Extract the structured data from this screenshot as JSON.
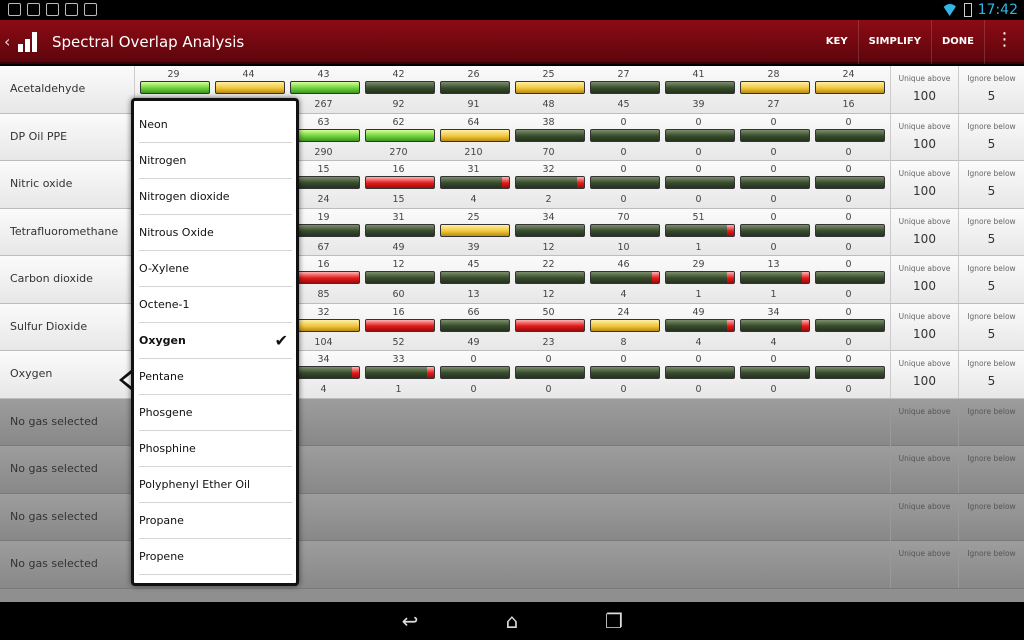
{
  "status_bar": {
    "time": "17:42",
    "notification_icons": [
      "download-icon",
      "image-icon",
      "android-icon",
      "shop-icon",
      "shop-icon"
    ]
  },
  "action_bar": {
    "title": "Spectral Overlap Analysis",
    "actions": [
      "KEY",
      "SIMPLIFY",
      "DONE"
    ]
  },
  "stat_labels": {
    "unique_above": "Unique above",
    "ignore_below": "Ignore below"
  },
  "rows": [
    {
      "gas": "Acetaldehyde",
      "unique_above": "100",
      "ignore_below": "5",
      "cells": [
        {
          "top": "29",
          "bot": "",
          "color": "green"
        },
        {
          "top": "44",
          "bot": "",
          "color": "yellow"
        },
        {
          "top": "43",
          "bot": "267",
          "color": "green"
        },
        {
          "top": "42",
          "bot": "92",
          "color": "dark"
        },
        {
          "top": "26",
          "bot": "91",
          "color": "dark"
        },
        {
          "top": "25",
          "bot": "48",
          "color": "yellow"
        },
        {
          "top": "27",
          "bot": "45",
          "color": "dark"
        },
        {
          "top": "41",
          "bot": "39",
          "color": "dark"
        },
        {
          "top": "28",
          "bot": "27",
          "color": "yellow"
        },
        {
          "top": "24",
          "bot": "16",
          "color": "yellow"
        }
      ]
    },
    {
      "gas": "DP Oil PPE",
      "unique_above": "100",
      "ignore_below": "5",
      "cells": [
        {
          "top": "",
          "bot": "",
          "color": "none"
        },
        {
          "top": "",
          "bot": "",
          "color": "none"
        },
        {
          "top": "63",
          "bot": "290",
          "color": "green"
        },
        {
          "top": "62",
          "bot": "270",
          "color": "green"
        },
        {
          "top": "64",
          "bot": "210",
          "color": "yellow"
        },
        {
          "top": "38",
          "bot": "70",
          "color": "dark"
        },
        {
          "top": "0",
          "bot": "0",
          "color": "dark"
        },
        {
          "top": "0",
          "bot": "0",
          "color": "dark"
        },
        {
          "top": "0",
          "bot": "0",
          "color": "dark"
        },
        {
          "top": "0",
          "bot": "0",
          "color": "dark"
        }
      ]
    },
    {
      "gas": "Nitric oxide",
      "unique_above": "100",
      "ignore_below": "5",
      "cells": [
        {
          "top": "",
          "bot": "",
          "color": "none"
        },
        {
          "top": "",
          "bot": "",
          "color": "none"
        },
        {
          "top": "15",
          "bot": "24",
          "color": "dark"
        },
        {
          "top": "16",
          "bot": "15",
          "color": "red"
        },
        {
          "top": "31",
          "bot": "4",
          "color": "darkred"
        },
        {
          "top": "32",
          "bot": "2",
          "color": "darkred"
        },
        {
          "top": "0",
          "bot": "0",
          "color": "dark"
        },
        {
          "top": "0",
          "bot": "0",
          "color": "dark"
        },
        {
          "top": "0",
          "bot": "0",
          "color": "dark"
        },
        {
          "top": "0",
          "bot": "0",
          "color": "dark"
        }
      ]
    },
    {
      "gas": "Tetrafluoromethane",
      "unique_above": "100",
      "ignore_below": "5",
      "cells": [
        {
          "top": "",
          "bot": "",
          "color": "none"
        },
        {
          "top": "",
          "bot": "",
          "color": "none"
        },
        {
          "top": "19",
          "bot": "67",
          "color": "dark"
        },
        {
          "top": "31",
          "bot": "49",
          "color": "dark"
        },
        {
          "top": "25",
          "bot": "39",
          "color": "yellow"
        },
        {
          "top": "34",
          "bot": "12",
          "color": "dark"
        },
        {
          "top": "70",
          "bot": "10",
          "color": "dark"
        },
        {
          "top": "51",
          "bot": "1",
          "color": "darkred"
        },
        {
          "top": "0",
          "bot": "0",
          "color": "dark"
        },
        {
          "top": "0",
          "bot": "0",
          "color": "dark"
        }
      ]
    },
    {
      "gas": "Carbon dioxide",
      "unique_above": "100",
      "ignore_below": "5",
      "cells": [
        {
          "top": "",
          "bot": "",
          "color": "none"
        },
        {
          "top": "",
          "bot": "",
          "color": "none"
        },
        {
          "top": "16",
          "bot": "85",
          "color": "red"
        },
        {
          "top": "12",
          "bot": "60",
          "color": "dark"
        },
        {
          "top": "45",
          "bot": "13",
          "color": "dark"
        },
        {
          "top": "22",
          "bot": "12",
          "color": "dark"
        },
        {
          "top": "46",
          "bot": "4",
          "color": "darkred"
        },
        {
          "top": "29",
          "bot": "1",
          "color": "darkred"
        },
        {
          "top": "13",
          "bot": "1",
          "color": "darkred"
        },
        {
          "top": "0",
          "bot": "0",
          "color": "dark"
        }
      ]
    },
    {
      "gas": "Sulfur Dioxide",
      "unique_above": "100",
      "ignore_below": "5",
      "cells": [
        {
          "top": "",
          "bot": "",
          "color": "none"
        },
        {
          "top": "",
          "bot": "",
          "color": "none"
        },
        {
          "top": "32",
          "bot": "104",
          "color": "yellow"
        },
        {
          "top": "16",
          "bot": "52",
          "color": "red"
        },
        {
          "top": "66",
          "bot": "49",
          "color": "dark"
        },
        {
          "top": "50",
          "bot": "23",
          "color": "red"
        },
        {
          "top": "24",
          "bot": "8",
          "color": "yellow"
        },
        {
          "top": "49",
          "bot": "4",
          "color": "darkred"
        },
        {
          "top": "34",
          "bot": "4",
          "color": "darkred"
        },
        {
          "top": "0",
          "bot": "0",
          "color": "dark"
        }
      ]
    },
    {
      "gas": "Oxygen",
      "unique_above": "100",
      "ignore_below": "5",
      "cells": [
        {
          "top": "",
          "bot": "",
          "color": "none"
        },
        {
          "top": "",
          "bot": "",
          "color": "none"
        },
        {
          "top": "34",
          "bot": "4",
          "color": "darkred"
        },
        {
          "top": "33",
          "bot": "1",
          "color": "darkred"
        },
        {
          "top": "0",
          "bot": "0",
          "color": "dark"
        },
        {
          "top": "0",
          "bot": "0",
          "color": "dark"
        },
        {
          "top": "0",
          "bot": "0",
          "color": "dark"
        },
        {
          "top": "0",
          "bot": "0",
          "color": "dark"
        },
        {
          "top": "0",
          "bot": "0",
          "color": "dark"
        },
        {
          "top": "0",
          "bot": "0",
          "color": "dark"
        }
      ]
    },
    {
      "gas": "No gas selected",
      "unique_above": "",
      "ignore_below": "",
      "cells": []
    },
    {
      "gas": "No gas selected",
      "unique_above": "",
      "ignore_below": "",
      "cells": []
    },
    {
      "gas": "No gas selected",
      "unique_above": "",
      "ignore_below": "",
      "cells": []
    },
    {
      "gas": "No gas selected",
      "unique_above": "",
      "ignore_below": "",
      "cells": []
    }
  ],
  "dropdown": {
    "options": [
      "Neon",
      "Nitrogen",
      "Nitrogen dioxide",
      "Nitrous Oxide",
      "O-Xylene",
      "Octene-1",
      "Oxygen",
      "Pentane",
      "Phosgene",
      "Phosphine",
      "Polyphenyl Ether Oil",
      "Propane",
      "Propene"
    ],
    "selected": "Oxygen",
    "check_glyph": "✔"
  },
  "colors": {
    "accent": "#8c0b15",
    "bar_red": "#e21a1a",
    "bar_green": "#6ed23d",
    "bar_yellow": "#f0c63a",
    "bar_dark": "#364a2c"
  }
}
